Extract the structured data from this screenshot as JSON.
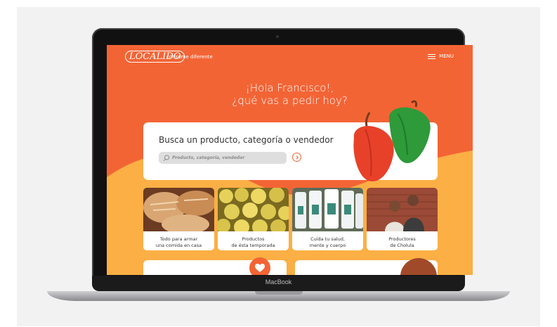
{
  "app": {
    "logo_text": "LOCÁLIDO",
    "tagline": "consume diferente",
    "menu_label": "MENU"
  },
  "hero": {
    "line1": "¡Hola Francisco!,",
    "line2": "¿qué vas a pedir hoy?"
  },
  "search": {
    "title": "Busca un producto, categoría o vendedor",
    "placeholder": "Producto, categoría, vendedor"
  },
  "categories": [
    {
      "line1": "Todo para armar",
      "line2": "una comida en casa",
      "image": "bread"
    },
    {
      "line1": "Productos",
      "line2": "de ésta temporada",
      "image": "guavas"
    },
    {
      "line1": "Cuida tu salud,",
      "line2": "mente y cuerpo",
      "image": "bottles"
    },
    {
      "line1": "Productores",
      "line2": "de Cholula",
      "image": "producers"
    }
  ],
  "device": {
    "label": "MacBook"
  },
  "colors": {
    "accent": "#f36435",
    "secondary": "#fbaf45",
    "card": "#ffffff"
  }
}
